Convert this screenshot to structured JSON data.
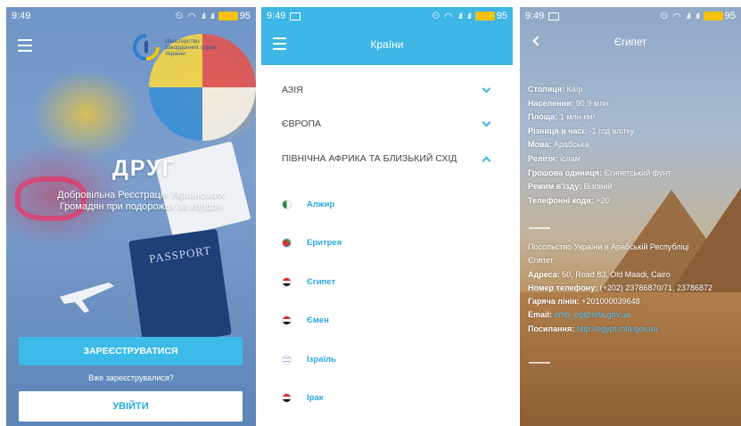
{
  "screens": {
    "login": {
      "status": {
        "time": "9:49",
        "battery": "95"
      },
      "ministry": {
        "line1": "Міністерство",
        "line2": "закордонних справ",
        "line3": "України"
      },
      "app_title": "ДРУГ",
      "subtitle_line1": "Добровільна Реєстрація Українських",
      "subtitle_line2": "Громадян при подорожах за кордон",
      "passport_label": "PASSPORT",
      "register_label": "ЗАРЕЄСТРУВАТИСЯ",
      "already_label": "Вже зареєструвалися?",
      "login_label": "УВІЙТИ"
    },
    "countries": {
      "status": {
        "time": "9:49",
        "battery": "95"
      },
      "title": "Країни",
      "regions": [
        "АЗІЯ",
        "ЄВРОПА",
        "ПІВНІЧНА АФРИКА ТА БЛИЗЬКИЙ СХІД"
      ],
      "countries": [
        "Алжир",
        "Еритрея",
        "Єгипет",
        "Ємен",
        "Ізраїль",
        "Ірак"
      ]
    },
    "egypt": {
      "status": {
        "time": "9:49",
        "battery": "95"
      },
      "title": "Єгипет",
      "facts": [
        {
          "label": "Столиця:",
          "value": "Каїр"
        },
        {
          "label": "Населення:",
          "value": "90,9 млн"
        },
        {
          "label": "Площа:",
          "value": "1 млн км²"
        },
        {
          "label": "Різниця в часі:",
          "value": "-1 год влітку"
        },
        {
          "label": "Мова:",
          "value": "Арабська"
        },
        {
          "label": "Релігія:",
          "value": "іслам"
        },
        {
          "label": "Грошова одиниця:",
          "value": "Єгипетський фунт"
        },
        {
          "label": "Режим в'їзду:",
          "value": "Візовий"
        },
        {
          "label": "Телефонні коди:",
          "value": "+20"
        }
      ],
      "embassy_line1": "Посольство України в Арабській Республіці",
      "embassy_line2": "Єгипет",
      "address_label": "Адреса:",
      "address_value": "50, Road 83, Old Maadi, Cairo",
      "phone_label": "Номер телефону:",
      "phone_value": "(+202) 23786870/71, 23786872",
      "hotline_label": "Гаряча лінія:",
      "hotline_value": "+201000039648",
      "email_label": "Email:",
      "email_value": "emb_eg@mfa.gov.ua",
      "link_label": "Посилання:",
      "link_value": "http://egypt.mfa.gov.ua"
    }
  },
  "colors": {
    "accent": "#3eb6e6",
    "link": "#2aa7e0",
    "battery": "#f3c20f"
  }
}
